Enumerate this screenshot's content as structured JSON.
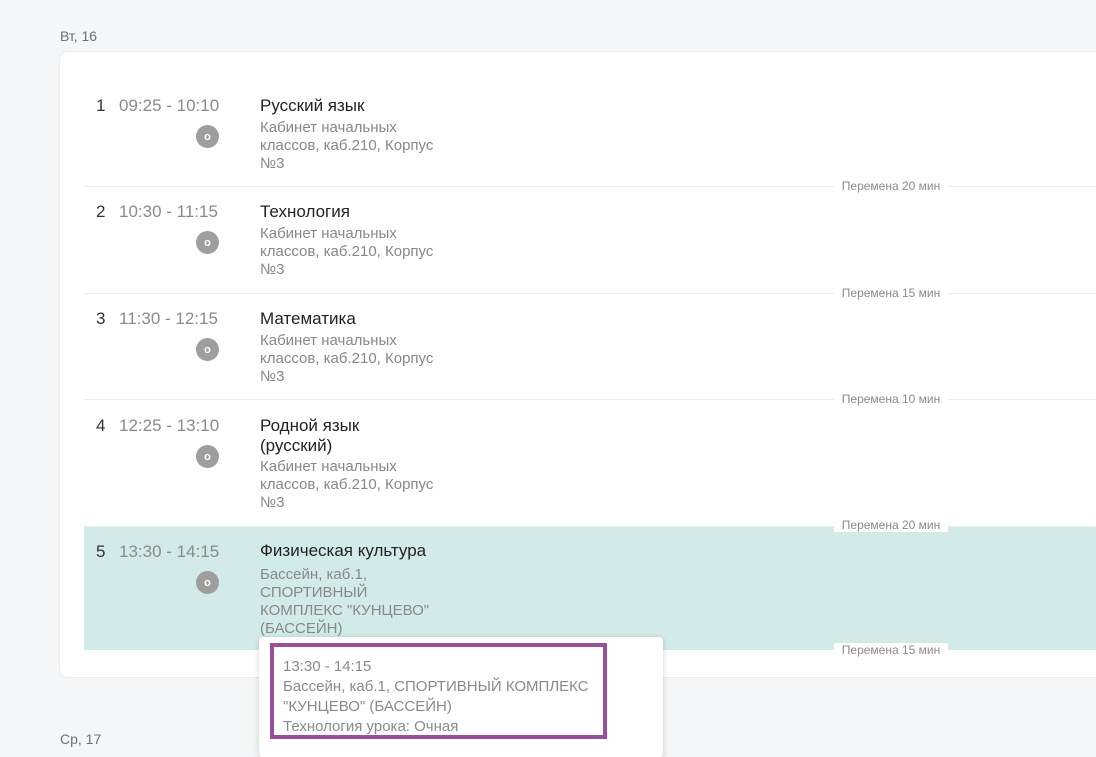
{
  "days": [
    {
      "label": "Вт, 16"
    },
    {
      "label": "Ср, 17"
    }
  ],
  "lessons": [
    {
      "num": "1",
      "time": "09:25 - 10:10",
      "badge": "о",
      "subject": "Русский язык",
      "room": "Кабинет начальных классов, каб.210, Корпус №3"
    },
    {
      "num": "2",
      "time": "10:30 - 11:15",
      "badge": "о",
      "subject": "Технология",
      "room": "Кабинет начальных классов, каб.210, Корпус №3"
    },
    {
      "num": "3",
      "time": "11:30 - 12:15",
      "badge": "о",
      "subject": "Математика",
      "room": "Кабинет начальных классов, каб.210, Корпус №3"
    },
    {
      "num": "4",
      "time": "12:25 - 13:10",
      "badge": "о",
      "subject": "Родной язык (русский)",
      "room": "Кабинет начальных классов, каб.210, Корпус №3"
    },
    {
      "num": "5",
      "time": "13:30 - 14:15",
      "badge": "о",
      "subject": "Физическая культура",
      "room": "Бассейн, каб.1, СПОРТИВНЫЙ КОМПЛЕКС \"КУНЦЕВО\" (БАССЕЙН)"
    }
  ],
  "breaks": [
    "Перемена 20 мин",
    "Перемена 15 мин",
    "Перемена 10 мин",
    "Перемена 20 мин",
    "Перемена 15 мин"
  ],
  "popup": {
    "time": "13:30 - 14:15",
    "location": "Бассейн, каб.1, СПОРТИВНЫЙ КОМПЛЕКС \"КУНЦЕВО\" (БАССЕЙН)",
    "technology": "Технология урока: Очная"
  },
  "colors": {
    "highlight": "#d2ebe8",
    "popup_frame": "#984f9c",
    "badge": "#9e9e9e"
  }
}
